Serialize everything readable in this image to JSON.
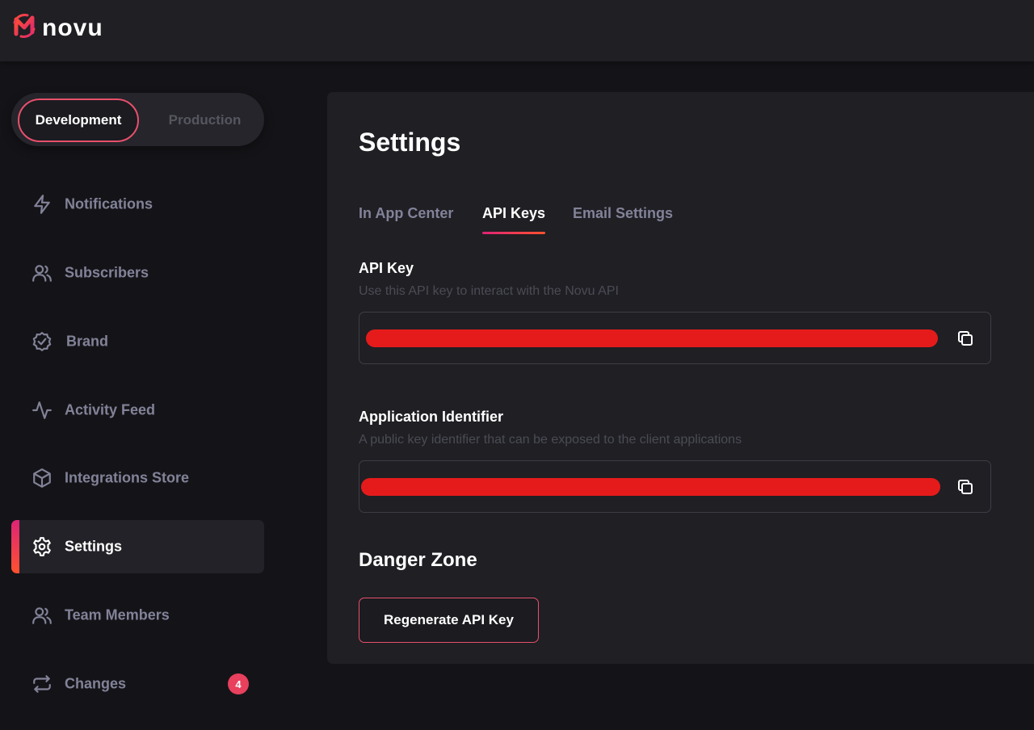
{
  "app": {
    "logo_text": "novu",
    "brand_gradient": [
      "#ff512f",
      "#dd2476"
    ]
  },
  "environment": {
    "options": [
      "Development",
      "Production"
    ],
    "selected": "Development"
  },
  "sidebar": {
    "items": [
      {
        "label": "Notifications",
        "icon": "bolt-icon",
        "active": false
      },
      {
        "label": "Subscribers",
        "icon": "users-icon",
        "active": false
      },
      {
        "label": "Brand",
        "icon": "badge-check-icon",
        "active": false
      },
      {
        "label": "Activity Feed",
        "icon": "activity-icon",
        "active": false
      },
      {
        "label": "Integrations Store",
        "icon": "box-icon",
        "active": false
      },
      {
        "label": "Settings",
        "icon": "gear-icon",
        "active": true
      },
      {
        "label": "Team Members",
        "icon": "users-icon",
        "active": false
      },
      {
        "label": "Changes",
        "icon": "repeat-icon",
        "active": false,
        "badge": "4"
      }
    ]
  },
  "main": {
    "title": "Settings",
    "tabs": [
      {
        "label": "In App Center",
        "active": false
      },
      {
        "label": "API Keys",
        "active": true
      },
      {
        "label": "Email Settings",
        "active": false
      }
    ],
    "api_key": {
      "label": "API Key",
      "description": "Use this API key to interact with the Novu API",
      "value": "",
      "copy_icon": "copy-icon"
    },
    "app_identifier": {
      "label": "Application Identifier",
      "description": "A public key identifier that can be exposed to the client applications",
      "value": "",
      "copy_icon": "copy-icon"
    },
    "danger_zone": {
      "title": "Danger Zone",
      "button_label": "Regenerate API Key"
    }
  }
}
